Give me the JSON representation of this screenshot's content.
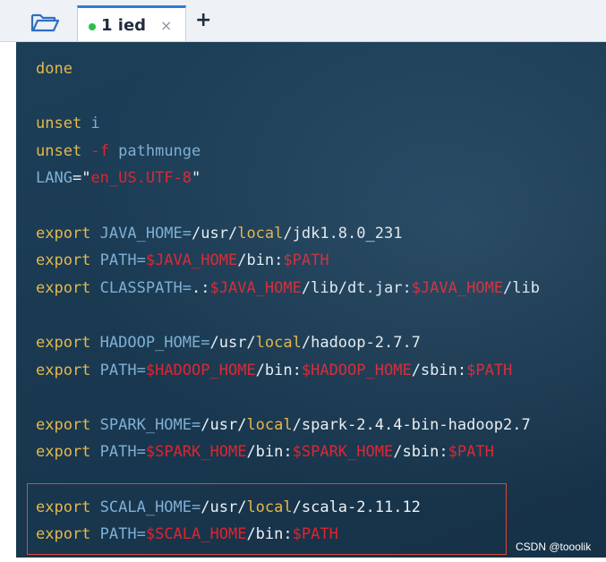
{
  "window": {
    "tab_label": "1 ied",
    "tab_close": "×",
    "new_tab": "+",
    "colors": {
      "keyword": "#e6b84a",
      "variable": "#7fb0d6",
      "string": "#e0242f",
      "text": "#eef2f5",
      "active_tab": "#2f7bd6",
      "status_dot": "#2bbf4c"
    },
    "icons": {
      "folder": "folder-open-icon",
      "dot": "connected-dot-icon"
    }
  },
  "terminal": {
    "lines": [
      [
        {
          "t": "done",
          "c": "kw"
        }
      ],
      [],
      [
        {
          "t": "unset ",
          "c": "kw"
        },
        {
          "t": "i",
          "c": "var"
        }
      ],
      [
        {
          "t": "unset ",
          "c": "kw"
        },
        {
          "t": "-f",
          "c": "red"
        },
        {
          "t": " pathmunge",
          "c": "var"
        }
      ],
      [
        {
          "t": "LANG",
          "c": "var"
        },
        {
          "t": "=\"",
          "c": "txt"
        },
        {
          "t": "en_US.UTF-8",
          "c": "red"
        },
        {
          "t": "\"",
          "c": "txt"
        }
      ],
      [],
      [
        {
          "t": "export ",
          "c": "kw"
        },
        {
          "t": "JAVA_HOME=",
          "c": "var"
        },
        {
          "t": "/usr/",
          "c": "txt"
        },
        {
          "t": "local",
          "c": "kw"
        },
        {
          "t": "/jdk1.8.0_231",
          "c": "txt"
        }
      ],
      [
        {
          "t": "export ",
          "c": "kw"
        },
        {
          "t": "PATH=",
          "c": "var"
        },
        {
          "t": "$JAVA_HOME",
          "c": "red"
        },
        {
          "t": "/bin:",
          "c": "txt"
        },
        {
          "t": "$PATH",
          "c": "red"
        }
      ],
      [
        {
          "t": "export ",
          "c": "kw"
        },
        {
          "t": "CLASSPATH=",
          "c": "var"
        },
        {
          "t": ".:",
          "c": "txt"
        },
        {
          "t": "$JAVA_HOME",
          "c": "red"
        },
        {
          "t": "/lib/dt.jar:",
          "c": "txt"
        },
        {
          "t": "$JAVA_HOME",
          "c": "red"
        },
        {
          "t": "/lib",
          "c": "txt"
        }
      ],
      [],
      [
        {
          "t": "export ",
          "c": "kw"
        },
        {
          "t": "HADOOP_HOME=",
          "c": "var"
        },
        {
          "t": "/usr/",
          "c": "txt"
        },
        {
          "t": "local",
          "c": "kw"
        },
        {
          "t": "/hadoop-2.7.7",
          "c": "txt"
        }
      ],
      [
        {
          "t": "export ",
          "c": "kw"
        },
        {
          "t": "PATH=",
          "c": "var"
        },
        {
          "t": "$HADOOP_HOME",
          "c": "red"
        },
        {
          "t": "/bin:",
          "c": "txt"
        },
        {
          "t": "$HADOOP_HOME",
          "c": "red"
        },
        {
          "t": "/sbin:",
          "c": "txt"
        },
        {
          "t": "$PATH",
          "c": "red"
        }
      ],
      [],
      [
        {
          "t": "export ",
          "c": "kw"
        },
        {
          "t": "SPARK_HOME=",
          "c": "var"
        },
        {
          "t": "/usr/",
          "c": "txt"
        },
        {
          "t": "local",
          "c": "kw"
        },
        {
          "t": "/spark-2.4.4-bin-hadoop2.7",
          "c": "txt"
        }
      ],
      [
        {
          "t": "export ",
          "c": "kw"
        },
        {
          "t": "PATH=",
          "c": "var"
        },
        {
          "t": "$SPARK_HOME",
          "c": "red"
        },
        {
          "t": "/bin:",
          "c": "txt"
        },
        {
          "t": "$SPARK_HOME",
          "c": "red"
        },
        {
          "t": "/sbin:",
          "c": "txt"
        },
        {
          "t": "$PATH",
          "c": "red"
        }
      ],
      [],
      [
        {
          "t": "export ",
          "c": "kw"
        },
        {
          "t": "SCALA_HOME=",
          "c": "var"
        },
        {
          "t": "/usr/",
          "c": "txt"
        },
        {
          "t": "local",
          "c": "kw"
        },
        {
          "t": "/scala-2.11.12",
          "c": "txt"
        }
      ],
      [
        {
          "t": "export ",
          "c": "kw"
        },
        {
          "t": "PATH=",
          "c": "var"
        },
        {
          "t": "$SCALA_HOME",
          "c": "red"
        },
        {
          "t": "/bin:",
          "c": "txt"
        },
        {
          "t": "$PATH",
          "c": "red"
        }
      ]
    ]
  },
  "watermark": "CSDN @tooolik"
}
